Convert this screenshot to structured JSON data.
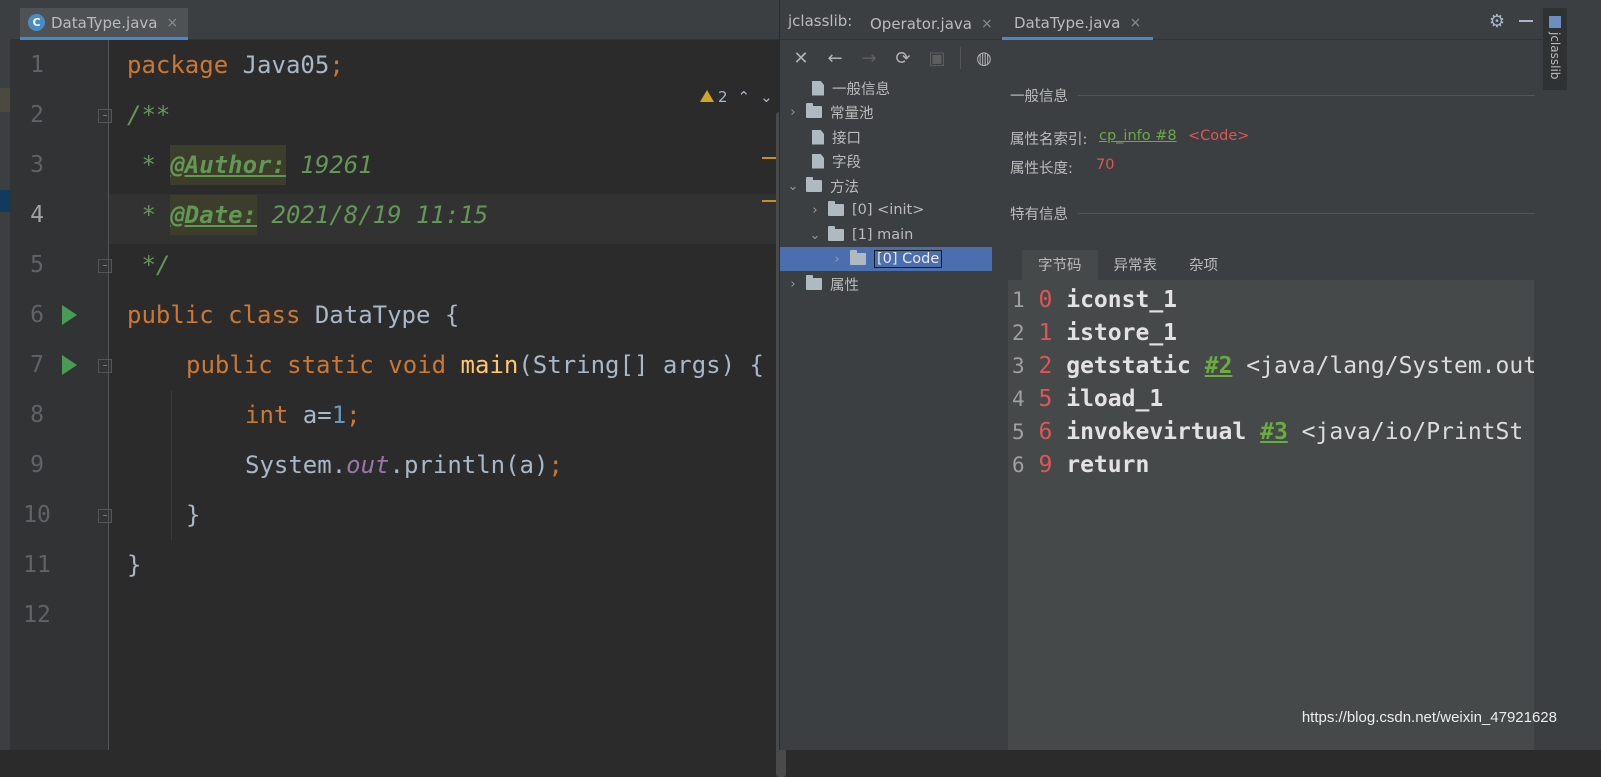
{
  "editor": {
    "tab": {
      "label": "DataType.java",
      "icon": "java-class-icon",
      "close": "×"
    },
    "inspection": {
      "warnings": "2"
    },
    "lines": [
      "1",
      "2",
      "3",
      "4",
      "5",
      "6",
      "7",
      "8",
      "9",
      "10",
      "11",
      "12"
    ],
    "code": {
      "l1_kw": "package",
      "l1_rest": " Java05",
      "l1_semi": ";",
      "l2": "/**",
      "l3_star": " * ",
      "l3_tag": "@Author:",
      "l3_val": " 19261",
      "l4_star": " * ",
      "l4_tag": "@Date:",
      "l4_val": " 2021/8/19 11:15",
      "l5": " */",
      "l6_kw": "public class",
      "l6_rest": " DataType {",
      "l7_kw": "public static void",
      "l7_fn": " main",
      "l7_rest": "(String[] args) {",
      "l8_kw": "int",
      "l8_var": " a=",
      "l8_num": "1",
      "l8_semi": ";",
      "l9_a": "System.",
      "l9_fld": "out",
      "l9_b": ".println(a)",
      "l9_semi": ";",
      "l10": "}",
      "l11": "}"
    }
  },
  "jclasslib": {
    "title": "jclasslib:",
    "tabs": [
      {
        "label": "Operator.java"
      },
      {
        "label": "DataType.java"
      }
    ],
    "close": "×",
    "tree": {
      "general": "一般信息",
      "constant_pool": "常量池",
      "interfaces": "接口",
      "fields": "字段",
      "methods": "方法",
      "init": "[0] <init>",
      "main": "[1] main",
      "code": "[0] Code",
      "attributes": "属性"
    },
    "detail": {
      "general_title": "一般信息",
      "name_index_label": "属性名索引:",
      "name_index_link": "cp_info #8",
      "name_index_value": "<Code>",
      "length_label": "属性长度:",
      "length_value": "70",
      "specific_title": "特有信息",
      "sub_tabs": [
        "字节码",
        "异常表",
        "杂项"
      ]
    },
    "bytecode": [
      {
        "line": "1",
        "offset": "0",
        "op": "iconst_1",
        "ref": "",
        "arg": ""
      },
      {
        "line": "2",
        "offset": "1",
        "op": "istore_1",
        "ref": "",
        "arg": ""
      },
      {
        "line": "3",
        "offset": "2",
        "op": "getstatic",
        "ref": "#2",
        "arg": " <java/lang/System.out"
      },
      {
        "line": "4",
        "offset": "5",
        "op": "iload_1",
        "ref": "",
        "arg": ""
      },
      {
        "line": "5",
        "offset": "6",
        "op": "invokevirtual",
        "ref": "#3",
        "arg": " <java/io/PrintSt"
      },
      {
        "line": "6",
        "offset": "9",
        "op": "return",
        "ref": "",
        "arg": ""
      }
    ],
    "side_tool": "jclasslib"
  },
  "watermark": "https://blog.csdn.net/weixin_47921628"
}
